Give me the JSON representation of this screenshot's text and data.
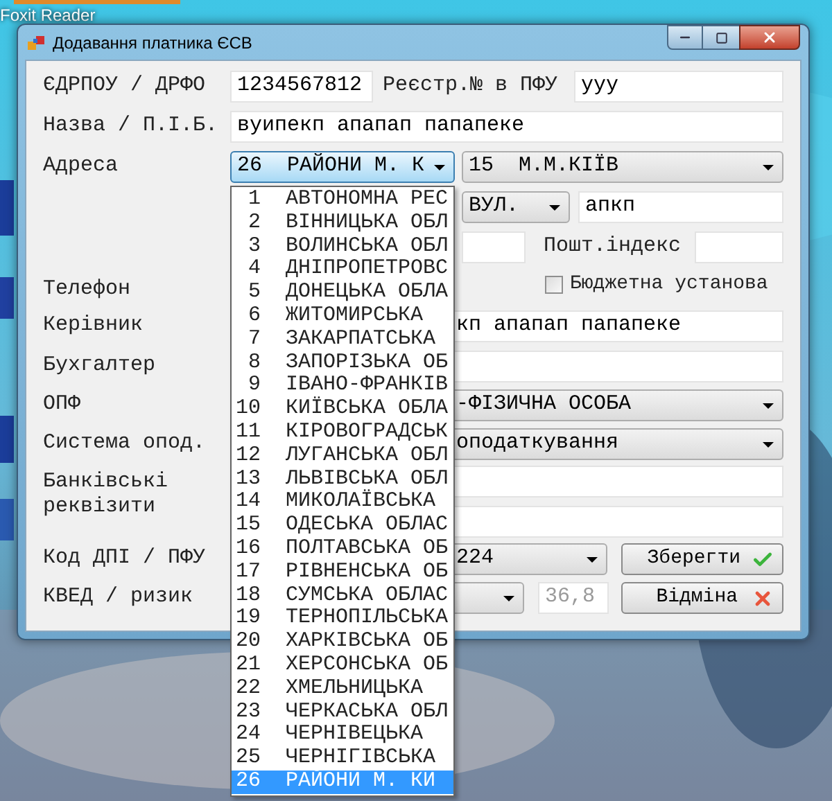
{
  "desktop": {
    "icon_label": "Foxit Reader"
  },
  "window": {
    "title": "Додавання платника ЄСВ"
  },
  "form": {
    "edrpou": {
      "label": "ЄДРПОУ / ДРФО",
      "value": "1234567812"
    },
    "pfu_reg": {
      "label": "Реєстр.№ в ПФУ",
      "value": "ууу"
    },
    "name": {
      "label": "Назва / П.І.Б.",
      "value": "вуипекп апапап папапеке"
    },
    "address": {
      "label": "Адреса",
      "region": "26  РАЙОНИ М. К",
      "city": "15  М.М.КІЇВ",
      "street_type": "ВУЛ.",
      "street": "апкп",
      "postal_label": "Пошт.індекс"
    },
    "budget": {
      "label": "Бюджетна установа",
      "checked": false
    },
    "phone": {
      "label": "Телефон"
    },
    "director": {
      "label": "Керівник",
      "value": "кп апапап папапеке"
    },
    "accountant": {
      "label": "Бухгалтер"
    },
    "opf": {
      "label": "ОПФ",
      "value": "-ФІЗИЧНА ОСОБА"
    },
    "tax_system": {
      "label": "Система опод.",
      "value": "оподаткування"
    },
    "bank": {
      "label": "Банківські реквізити"
    },
    "dpi": {
      "label": "Код ДПІ / ПФУ",
      "value": "224"
    },
    "kved": {
      "label": "КВЕД / ризик",
      "risk": "36,8"
    },
    "save_button": "Зберегти",
    "cancel_button": "Відміна"
  },
  "region_list": [
    {
      "label": " 1  АВТОНОМНА РЕС",
      "selected": false
    },
    {
      "label": " 2  ВІННИЦЬКА ОБЛ",
      "selected": false
    },
    {
      "label": " 3  ВОЛИНСЬКА ОБЛ",
      "selected": false
    },
    {
      "label": " 4  ДНІПРОПЕТРОВС",
      "selected": false
    },
    {
      "label": " 5  ДОНЕЦЬКА ОБЛА",
      "selected": false
    },
    {
      "label": " 6  ЖИТОМИРСЬКА",
      "selected": false
    },
    {
      "label": " 7  ЗАКАРПАТСЬКА",
      "selected": false
    },
    {
      "label": " 8  ЗАПОРІЗЬКА ОБ",
      "selected": false
    },
    {
      "label": " 9  ІВАНО-ФРАНКІВ",
      "selected": false
    },
    {
      "label": "10  КИЇВСЬКА ОБЛА",
      "selected": false
    },
    {
      "label": "11  КІРОВОГРАДСЬК",
      "selected": false
    },
    {
      "label": "12  ЛУГАНСЬКА ОБЛ",
      "selected": false
    },
    {
      "label": "13  ЛЬВІВСЬКА ОБЛ",
      "selected": false
    },
    {
      "label": "14  МИКОЛАЇВСЬКА",
      "selected": false
    },
    {
      "label": "15  ОДЕСЬКА ОБЛАС",
      "selected": false
    },
    {
      "label": "16  ПОЛТАВСЬКА ОБ",
      "selected": false
    },
    {
      "label": "17  РІВНЕНСЬКА ОБ",
      "selected": false
    },
    {
      "label": "18  СУМСЬКА ОБЛАС",
      "selected": false
    },
    {
      "label": "19  ТЕРНОПІЛЬСЬКА",
      "selected": false
    },
    {
      "label": "20  ХАРКІВСЬКА ОБ",
      "selected": false
    },
    {
      "label": "21  ХЕРСОНСЬКА ОБ",
      "selected": false
    },
    {
      "label": "22  ХМЕЛЬНИЦЬКА",
      "selected": false
    },
    {
      "label": "23  ЧЕРКАСЬКА ОБЛ",
      "selected": false
    },
    {
      "label": "24  ЧЕРНІВЕЦЬКА",
      "selected": false
    },
    {
      "label": "25  ЧЕРНІГІВСЬКА",
      "selected": false
    },
    {
      "label": "26  РАЙОНИ М. КИ",
      "selected": true
    }
  ]
}
